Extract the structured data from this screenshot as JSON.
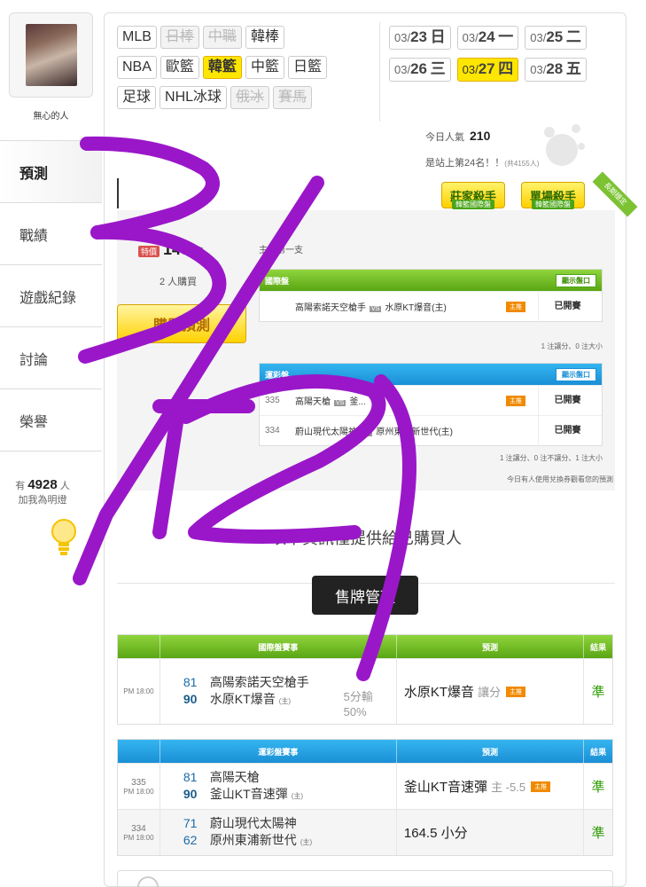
{
  "user": {
    "name": "無心的人"
  },
  "nav": {
    "items": [
      {
        "label": "預測",
        "active": true
      },
      {
        "label": "戰績"
      },
      {
        "label": "遊戲紀錄"
      },
      {
        "label": "討論"
      },
      {
        "label": "榮譽"
      }
    ]
  },
  "fans": {
    "prefix": "有",
    "count": "4928",
    "suffix": "人",
    "cta": "加我為明燈"
  },
  "sports": {
    "row1": [
      "MLB",
      "日棒",
      "中職",
      "韓棒"
    ],
    "row2": [
      "NBA",
      "歐籃",
      "韓籃",
      "中籃",
      "日籃"
    ],
    "row3": [
      "足球",
      "NHL冰球",
      "俄冰",
      "賽馬"
    ]
  },
  "dates": {
    "row1": [
      {
        "md": "03/",
        "d": "23",
        "w": "日"
      },
      {
        "md": "03/",
        "d": "24",
        "w": "一"
      },
      {
        "md": "03/",
        "d": "25",
        "w": "二"
      }
    ],
    "row2": [
      {
        "md": "03/",
        "d": "26",
        "w": "三"
      },
      {
        "md": "03/",
        "d": "27",
        "w": "四"
      },
      {
        "md": "03/",
        "d": "28",
        "w": "五"
      }
    ]
  },
  "stats": {
    "popularity_label": "今日人氣",
    "popularity_value": "210",
    "rank_text": "是站上第24名！！",
    "rank_total": "(共4155人)"
  },
  "badges": {
    "badge1": "莊家殺手",
    "badge1_sub": "韓籃國際盤",
    "badge2": "單場殺手",
    "badge2_sub": "韓籃國際盤",
    "ribbon": "長期穩定"
  },
  "purchase": {
    "hot": "特價",
    "price": "148",
    "price_suffix": "路",
    "buyers": "2 人購買",
    "buy_button": "購買預測",
    "main_pick": "主推第一支"
  },
  "intl_table": {
    "title": "國際盤",
    "show": "顯示盤口",
    "teams_away": "高陽索諾天空槍手",
    "teams_home": "水原KT爆音(主)",
    "tag": "主推",
    "status": "已開賽",
    "note": "1 注讓分、0 注大小"
  },
  "sport_table": {
    "title": "運彩盤",
    "show": "顯示盤口",
    "rows": [
      {
        "no": "335",
        "away": "高陽天槍",
        "home": "釜...",
        "tag": "主推",
        "status": "已開賽"
      },
      {
        "no": "334",
        "away": "蔚山現代太陽神",
        "home": "原州東浦新世代(主)",
        "tag": "",
        "status": "已開賽"
      }
    ],
    "note": "1 注讓分、0 注不讓分、1 注大小",
    "note2": "今日有人使用兌換券觀看您的預測"
  },
  "info_text": "以下資訊僅提供給已購買人",
  "sell_button": "售牌管理",
  "results_intl": {
    "head": [
      "國際盤賽事",
      "預測",
      "結果"
    ],
    "row": {
      "time": "PM 18:00",
      "away_score": "81",
      "away": "高陽索諾天空槍手",
      "home_score": "90",
      "home": "水原KT爆音",
      "home_tag": "(主)",
      "loss": "5分輸",
      "loss_pct": "50%",
      "pred": "水原KT爆音",
      "pred_extra": "讓分",
      "pick_tag": "主推",
      "result": "準"
    }
  },
  "results_sport": {
    "head": [
      "運彩盤賽事",
      "預測",
      "結果"
    ],
    "rows": [
      {
        "no": "335",
        "time": "PM 18:00",
        "away_score": "81",
        "away": "高陽天槍",
        "home_score": "90",
        "home": "釜山KT音速彈",
        "home_tag": "(主)",
        "pred": "釜山KT音速彈",
        "pred_extra": "主 -5.5",
        "pick_tag": "主推",
        "result": "準"
      },
      {
        "no": "334",
        "time": "PM 18:00",
        "away_score": "71",
        "away": "蔚山現代太陽神",
        "home_score": "62",
        "home": "原州東浦新世代",
        "home_tag": "(主)",
        "pred": "164.5 小分",
        "pred_extra": "",
        "pick_tag": "",
        "result": "準"
      }
    ]
  },
  "colors": {
    "accent_yellow": "#ffe600",
    "green": "#5aa614",
    "blue": "#1a8fd6",
    "scribble": "#9a17c9"
  }
}
